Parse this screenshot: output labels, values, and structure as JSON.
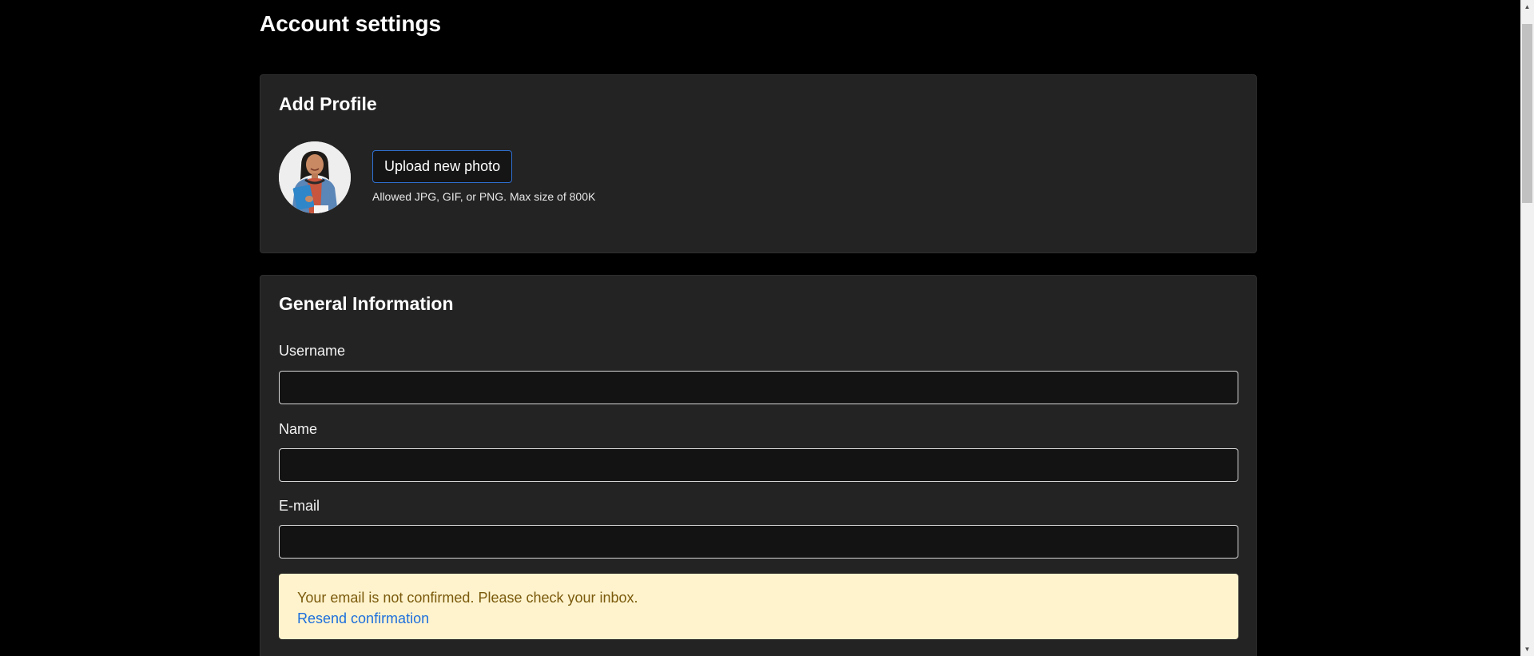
{
  "page": {
    "title": "Account settings"
  },
  "profile": {
    "title": "Add Profile",
    "upload_label": "Upload new photo",
    "hint": "Allowed JPG, GIF, or PNG. Max size of 800K"
  },
  "general": {
    "title": "General Information",
    "fields": [
      {
        "label": "Username",
        "value": ""
      },
      {
        "label": "Name",
        "value": ""
      },
      {
        "label": "E-mail",
        "value": ""
      }
    ],
    "alert": {
      "message": "Your email is not confirmed. Please check your inbox.",
      "link": "Resend confirmation"
    }
  },
  "colors": {
    "background": "#000000",
    "card": "#232323",
    "accent": "#2f6fd0",
    "warning_bg": "#fff3cd",
    "warning_text": "#7a5a0c",
    "link": "#1d6fdc"
  }
}
